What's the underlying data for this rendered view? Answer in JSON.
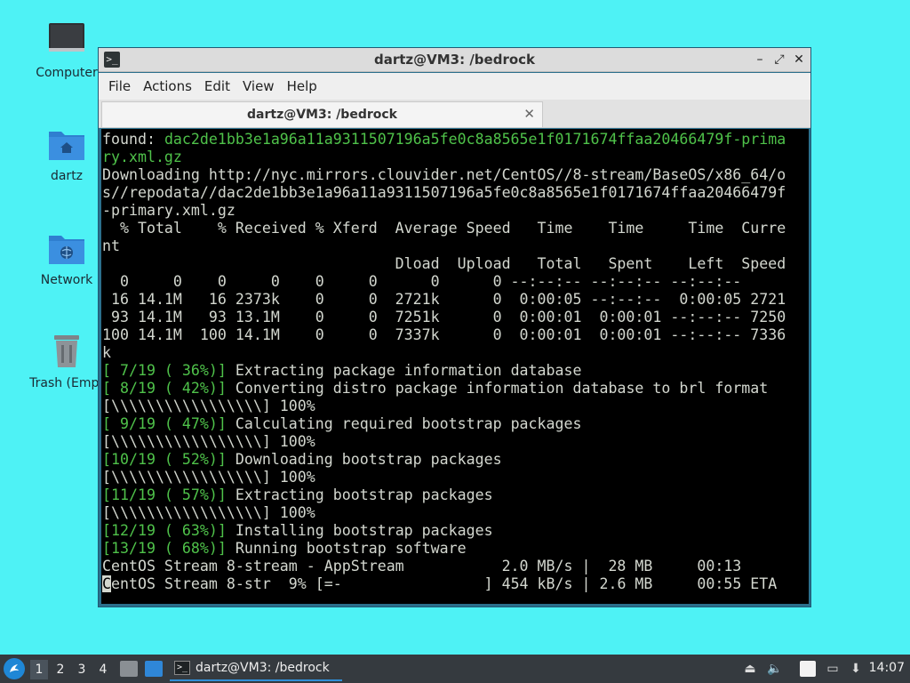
{
  "desktop": {
    "icons": [
      {
        "label": "Computer"
      },
      {
        "label": "dartz"
      },
      {
        "label": "Network"
      },
      {
        "label": "Trash (Empt"
      }
    ]
  },
  "window": {
    "title": "dartz@VM3: /bedrock",
    "minimize": "–",
    "maximize": "⤢",
    "close": "✕",
    "menu": [
      "File",
      "Actions",
      "Edit",
      "View",
      "Help"
    ],
    "tab": {
      "label": "dartz@VM3: /bedrock",
      "close": "✕"
    }
  },
  "terminal": {
    "lines": [
      [
        {
          "t": "found: "
        },
        {
          "t": "dac2de1bb3e1a96a11a9311507196a5fe0c8a8565e1f0171674ffaa20466479f-prima",
          "c": "g"
        }
      ],
      [
        {
          "t": "ry.xml.gz",
          "c": "g"
        }
      ],
      [
        {
          "t": "Downloading http://nyc.mirrors.clouvider.net/CentOS//8-stream/BaseOS/x86_64/o"
        }
      ],
      [
        {
          "t": "s//repodata//dac2de1bb3e1a96a11a9311507196a5fe0c8a8565e1f0171674ffaa20466479f"
        }
      ],
      [
        {
          "t": "-primary.xml.gz"
        }
      ],
      [
        {
          "t": "  % Total    % Received % Xferd  Average Speed   Time    Time     Time  Curre"
        }
      ],
      [
        {
          "t": "nt"
        }
      ],
      [
        {
          "t": "                                 Dload  Upload   Total   Spent    Left  Speed"
        }
      ],
      [
        {
          "t": "  0     0    0     0    0     0      0      0 --:--:-- --:--:-- --:--:--"
        }
      ],
      [
        {
          "t": " 16 14.1M   16 2373k    0     0  2721k      0  0:00:05 --:--:--  0:00:05 2721"
        }
      ],
      [
        {
          "t": " 93 14.1M   93 13.1M    0     0  7251k      0  0:00:01  0:00:01 --:--:-- 7250"
        }
      ],
      [
        {
          "t": "100 14.1M  100 14.1M    0     0  7337k      0  0:00:01  0:00:01 --:--:-- 7336"
        }
      ],
      [
        {
          "t": "k"
        }
      ],
      [
        {
          "t": "[ 7/19 ( 36%)]",
          "c": "g"
        },
        {
          "t": " Extracting package information database"
        }
      ],
      [
        {
          "t": "[ 8/19 ( 42%)]",
          "c": "g"
        },
        {
          "t": " Converting distro package information database to brl format"
        }
      ],
      [
        {
          "t": "[\\\\\\\\\\\\\\\\\\\\\\\\\\\\\\\\\\] 100%"
        }
      ],
      [
        {
          "t": "[ 9/19 ( 47%)]",
          "c": "g"
        },
        {
          "t": " Calculating required bootstrap packages"
        }
      ],
      [
        {
          "t": "[\\\\\\\\\\\\\\\\\\\\\\\\\\\\\\\\\\] 100%"
        }
      ],
      [
        {
          "t": "[10/19 ( 52%)]",
          "c": "g"
        },
        {
          "t": " Downloading bootstrap packages"
        }
      ],
      [
        {
          "t": "[\\\\\\\\\\\\\\\\\\\\\\\\\\\\\\\\\\] 100%"
        }
      ],
      [
        {
          "t": "[11/19 ( 57%)]",
          "c": "g"
        },
        {
          "t": " Extracting bootstrap packages"
        }
      ],
      [
        {
          "t": "[\\\\\\\\\\\\\\\\\\\\\\\\\\\\\\\\\\] 100%"
        }
      ],
      [
        {
          "t": "[12/19 ( 63%)]",
          "c": "g"
        },
        {
          "t": " Installing bootstrap packages"
        }
      ],
      [
        {
          "t": "[13/19 ( 68%)]",
          "c": "g"
        },
        {
          "t": " Running bootstrap software"
        }
      ],
      [
        {
          "t": "CentOS Stream 8-stream - AppStream           2.0 MB/s |  28 MB     00:13"
        }
      ],
      [
        {
          "t": "C",
          "c": "cursor"
        },
        {
          "t": "entOS Stream 8-str  9% [=-                ] 454 kB/s | 2.6 MB     00:55 ETA"
        }
      ]
    ]
  },
  "taskbar": {
    "start_icon": "start-menu-icon",
    "workspaces": [
      "1",
      "2",
      "3",
      "4"
    ],
    "active_workspace": "1",
    "task_label": "dartz@VM3: /bedrock",
    "clock": "14:07"
  },
  "colors": {
    "desktop": "#4ef2f5",
    "terminal_bg": "#000000",
    "terminal_fg": "#d3d7cf",
    "terminal_green": "#4fc24a",
    "taskbar": "#353a3f"
  }
}
